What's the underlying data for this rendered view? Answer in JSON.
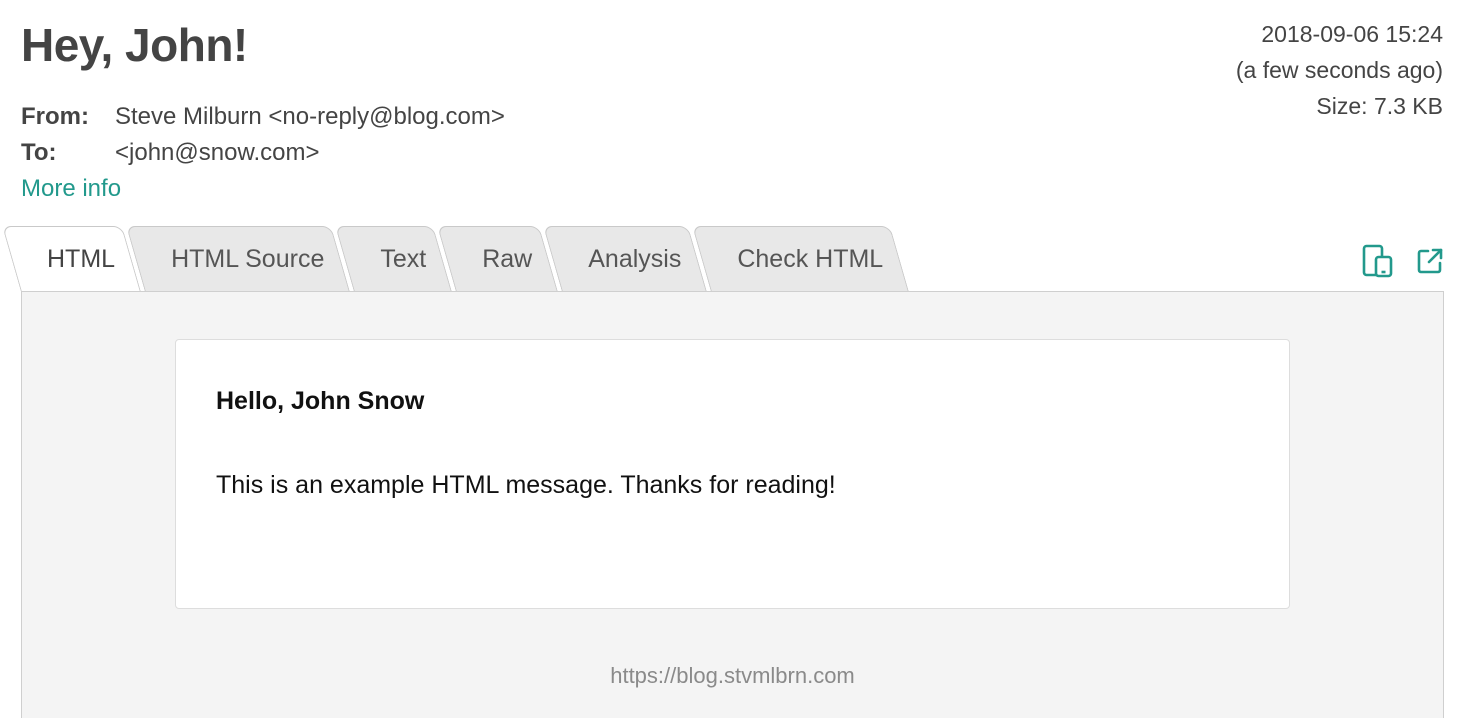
{
  "message": {
    "subject": "Hey, John!",
    "date": "2018-09-06 15:24",
    "relative_time": "(a few seconds ago)",
    "size": "Size: 7.3 KB",
    "from_label": "From:",
    "from_value": "Steve Milburn <no-reply@blog.com>",
    "to_label": "To:",
    "to_value": "<john@snow.com>",
    "more_info": "More info"
  },
  "tabs": [
    {
      "label": "HTML",
      "active": true
    },
    {
      "label": "HTML Source",
      "active": false
    },
    {
      "label": "Text",
      "active": false
    },
    {
      "label": "Raw",
      "active": false
    },
    {
      "label": "Analysis",
      "active": false
    },
    {
      "label": "Check HTML",
      "active": false
    }
  ],
  "toolbar": {
    "icons": [
      "responsive-devices-icon",
      "open-external-icon"
    ],
    "accent_color": "#22998c"
  },
  "body": {
    "greeting": "Hello, John Snow",
    "text": "This is an example HTML message. Thanks for reading!",
    "footer_link": "https://blog.stvmlbrn.com"
  }
}
